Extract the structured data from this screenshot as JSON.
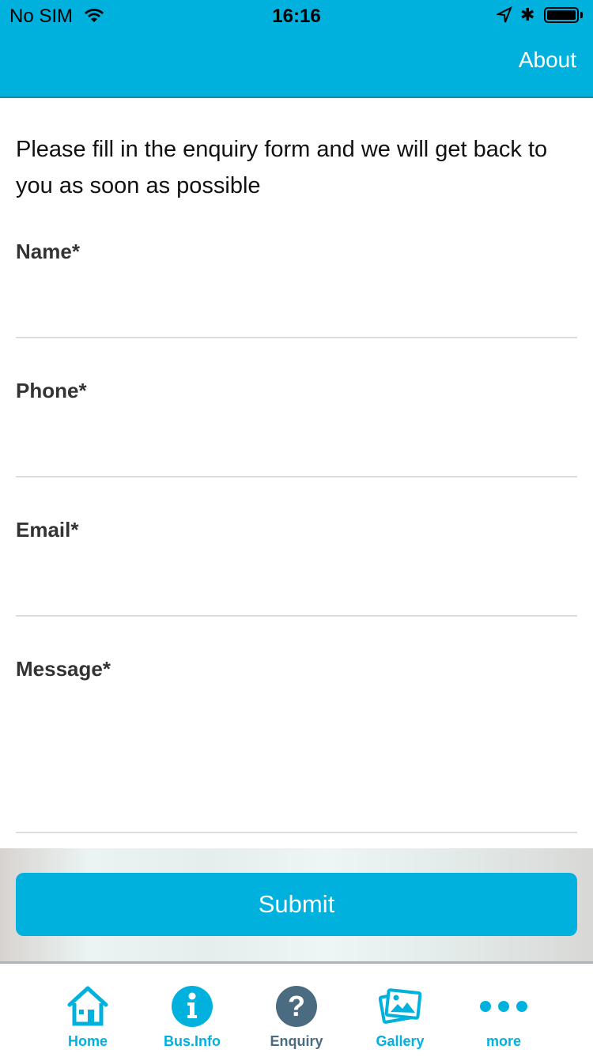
{
  "status_bar": {
    "carrier": "No SIM",
    "time": "16:16"
  },
  "header": {
    "about_label": "About"
  },
  "intro": "Please fill in the enquiry form and we will get back to you as soon as possible",
  "form": {
    "fields": [
      {
        "label": "Name*",
        "value": "",
        "placeholder": ""
      },
      {
        "label": "Phone*",
        "value": "",
        "placeholder": ""
      },
      {
        "label": "Email*",
        "value": "",
        "placeholder": ""
      },
      {
        "label": "Message*",
        "value": "",
        "placeholder": ""
      }
    ],
    "submit_label": "Submit"
  },
  "tabbar": {
    "items": [
      {
        "label": "Home",
        "icon": "home-icon"
      },
      {
        "label": "Bus.Info",
        "icon": "info-icon"
      },
      {
        "label": "Enquiry",
        "icon": "question-icon",
        "active": true
      },
      {
        "label": "Gallery",
        "icon": "gallery-icon"
      },
      {
        "label": "more",
        "icon": "more-icon"
      }
    ]
  },
  "colors": {
    "accent": "#00b1de",
    "active_tab": "#4a6b80"
  }
}
